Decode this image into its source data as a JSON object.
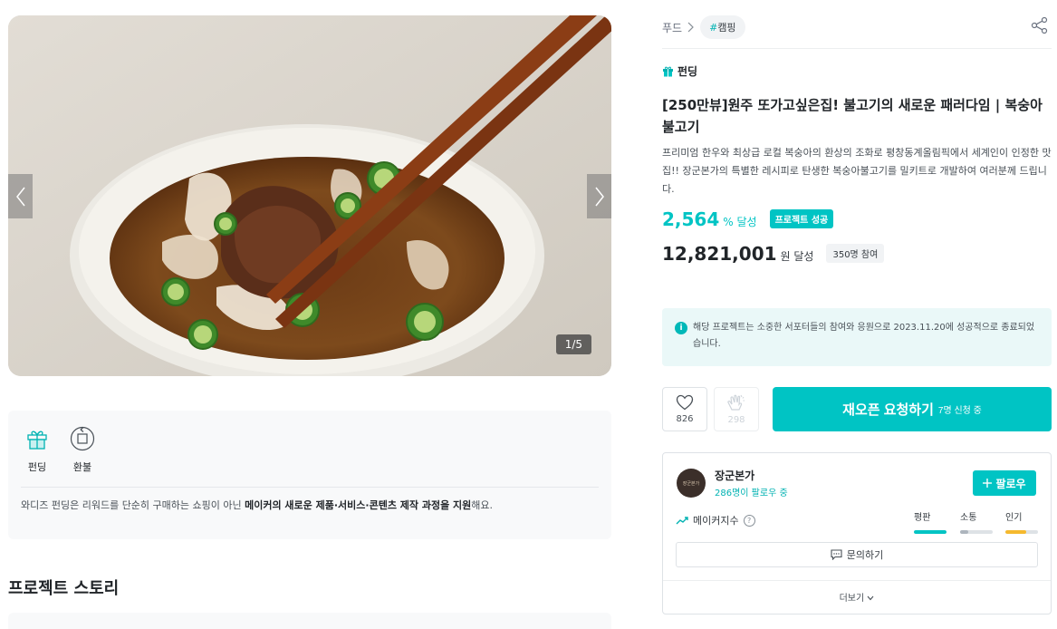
{
  "gallery": {
    "counter": "1/5"
  },
  "info": {
    "funding_label": "펀딩",
    "refund_label": "환불",
    "text_prefix": "와디즈 펀딩은 리워드를 단순히 구매하는 쇼핑이 아닌 ",
    "text_bold": "메이커의 새로운 제품·서비스·콘텐츠 제작 과정을 지원",
    "text_suffix": "해요."
  },
  "story": {
    "title": "프로젝트 스토리"
  },
  "breadcrumb": {
    "category": "푸드",
    "tag_hash": "#",
    "tag": "캠핑"
  },
  "project": {
    "badge": "펀딩",
    "title": "[250만뷰]원주 또가고싶은집! 불고기의 새로운 패러다임 | 복숭아불고기",
    "description": "프리미엄 한우와 최상급 로컬 복숭아의 환상의 조화로 평창동계올림픽에서 세계인이 인정한 맛집!! 장군본가의 특별한 레시피로 탄생한 복숭아불고기를 밀키트로 개발하여 여러분께 드립니다.",
    "rate": "2,564",
    "rate_unit": "% 달성",
    "success_badge": "프로젝트 성공",
    "amount": "12,821,001",
    "amount_unit": "원 달성",
    "backers": "350명 참여"
  },
  "notice": {
    "icon": "i",
    "text": "해당 프로젝트는 소중한 서포터들의 참여와 응원으로 2023.11.20에 성공적으로 종료되었습니다."
  },
  "actions": {
    "like_count": "826",
    "clap_count": "298",
    "reopen_label": "재오픈 요청하기",
    "reopen_sub": "7명 신청 중"
  },
  "maker": {
    "avatar_text": "장군본가",
    "name": "장군본가",
    "followers": "286명이 팔로우 중",
    "follow_label": "팔로우",
    "index_label": "메이커지수",
    "help": "?",
    "metrics": [
      {
        "label": "평판",
        "level": 1.0,
        "color": "#00c4c4"
      },
      {
        "label": "소통",
        "level": 0.25,
        "color": "#adb5bd"
      },
      {
        "label": "인기",
        "level": 0.65,
        "color": "#f5b92e"
      }
    ],
    "inquiry_label": "문의하기",
    "more_label": "더보기"
  },
  "icons": {
    "gift": "gift-icon",
    "refund": "refund-icon",
    "share": "share-icon",
    "heart": "heart-icon",
    "clap": "clap-icon",
    "chat": "chat-icon",
    "trend": "trend-icon",
    "chevron": "chevron-icon"
  },
  "colors": {
    "accent": "#00c4c4",
    "notice_bg": "#eaf8f8"
  }
}
